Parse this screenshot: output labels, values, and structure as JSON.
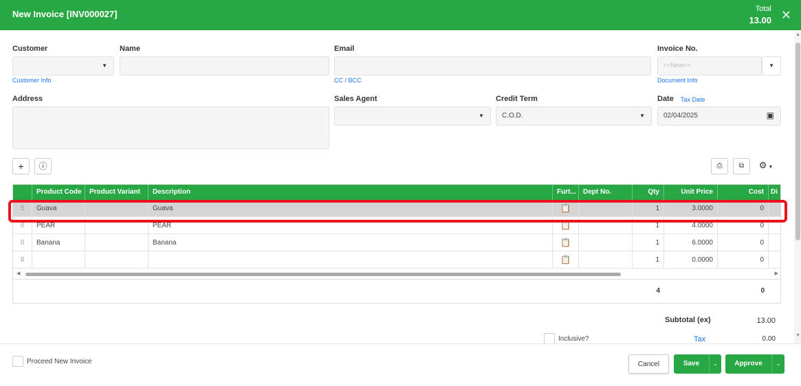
{
  "header": {
    "title": "New Invoice [INV000027]",
    "total_label": "Total",
    "total_value": "13.00"
  },
  "form": {
    "customer_label": "Customer",
    "customer_info_link": "Customer Info",
    "name_label": "Name",
    "email_label": "Email",
    "cc_bcc_link": "CC / BCC",
    "invoice_no_label": "Invoice No.",
    "invoice_no_placeholder": "<<New>>",
    "document_info_link": "Document Info",
    "address_label": "Address",
    "sales_agent_label": "Sales Agent",
    "credit_term_label": "Credit Term",
    "credit_term_value": "C.O.D.",
    "date_label": "Date",
    "tax_date_link": "Tax Date",
    "date_value": "02/04/2025"
  },
  "grid": {
    "columns": [
      "Product Code",
      "Product Variant",
      "Description",
      "Furt...",
      "Dept No.",
      "Qty",
      "Unit Price",
      "Cost",
      "Di"
    ],
    "rows": [
      {
        "code": "Guava",
        "variant": "",
        "description": "Guava",
        "dept": "",
        "qty": "1",
        "unit_price": "3.0000",
        "cost": "0"
      },
      {
        "code": "PEAR",
        "variant": "",
        "description": "PEAR",
        "dept": "",
        "qty": "1",
        "unit_price": "4.0000",
        "cost": "0"
      },
      {
        "code": "Banana",
        "variant": "",
        "description": "Banana",
        "dept": "",
        "qty": "1",
        "unit_price": "6.0000",
        "cost": "0"
      },
      {
        "code": "",
        "variant": "",
        "description": "",
        "dept": "",
        "qty": "1",
        "unit_price": "0.0000",
        "cost": "0"
      }
    ],
    "total_qty": "4",
    "total_cost": "0"
  },
  "summary": {
    "subtotal_label": "Subtotal (ex)",
    "subtotal_value": "13.00",
    "inclusive_label": "Inclusive?",
    "tax_label": "Tax",
    "tax_value": "0.00"
  },
  "footer": {
    "proceed_label": "Proceed New Invoice",
    "cancel_label": "Cancel",
    "save_label": "Save",
    "approve_label": "Approve"
  },
  "icons": {
    "close": "close-icon",
    "add": "plus-icon",
    "info": "info-icon",
    "export": "export-icon",
    "copy": "copy-icon",
    "settings": "gear-icon",
    "calendar": "calendar-icon",
    "drag": "drag-handle-icon",
    "clipboard": "clipboard-icon"
  },
  "colors": {
    "accent": "#28a745",
    "highlight": "#e8141e",
    "link": "#1a73e8"
  }
}
